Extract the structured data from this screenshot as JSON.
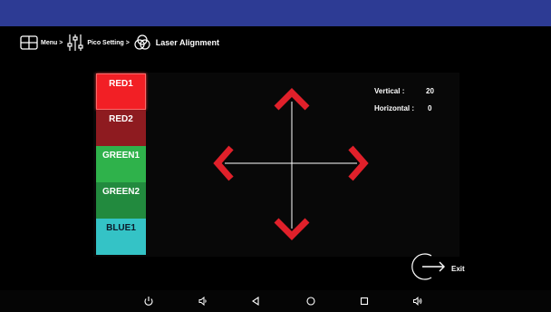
{
  "breadcrumb": {
    "menu_label": "Menu >",
    "pico_label": "Pico Setting >",
    "current_label": "Laser Alignment",
    "icons": [
      "grid-icon",
      "sliders-icon",
      "color-circles-icon"
    ]
  },
  "color_buttons": [
    {
      "label": "RED1",
      "selected": true,
      "color": "#f21f25"
    },
    {
      "label": "RED2",
      "selected": false,
      "color": "#8e1b20"
    },
    {
      "label": "GREEN1",
      "selected": false,
      "color": "#2fb24b"
    },
    {
      "label": "GREEN2",
      "selected": false,
      "color": "#228a3e"
    },
    {
      "label": "BLUE1",
      "selected": false,
      "color": "#34c3c6"
    }
  ],
  "readout": {
    "vertical_label": "Vertical :",
    "vertical_value": "20",
    "horizontal_label": "Horizontal :",
    "horizontal_value": "0"
  },
  "arrows": {
    "color": "#e0202a",
    "icons": [
      "arrow-up-icon",
      "arrow-down-icon",
      "arrow-left-icon",
      "arrow-right-icon"
    ]
  },
  "exit": {
    "label": "Exit",
    "icon": "exit-arrow-icon"
  },
  "navbar": {
    "icons": [
      "power-icon",
      "volume-down-icon",
      "back-icon",
      "home-icon",
      "recents-icon",
      "volume-up-icon"
    ]
  },
  "colors": {
    "topbar": "#2d3b94",
    "background": "#000000"
  }
}
